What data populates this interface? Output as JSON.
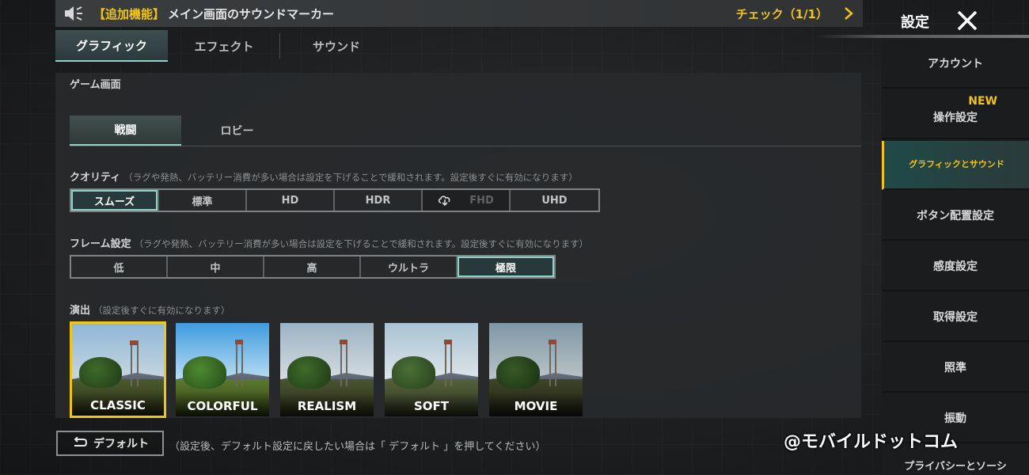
{
  "notice": {
    "tag": "【追加機能】",
    "message": "メイン画面のサウンドマーカー",
    "check": "チェック（1/1）"
  },
  "tabs": [
    {
      "label": "グラフィック",
      "active": true
    },
    {
      "label": "エフェクト",
      "active": false
    },
    {
      "label": "サウンド",
      "active": false
    }
  ],
  "section_title": "ゲーム画面",
  "subtabs": [
    {
      "label": "戦闘",
      "active": true
    },
    {
      "label": "ロビー",
      "active": false
    }
  ],
  "quality": {
    "label": "クオリティ",
    "note": "（ラグや発熱、バッテリー消費が多い場合は設定を下げることで緩和されます。設定後すぐに有効になります）",
    "options": [
      "スムーズ",
      "標準",
      "HD",
      "HDR",
      "FHD",
      "UHD"
    ],
    "selected": "スムーズ",
    "disabled": "FHD"
  },
  "frame": {
    "label": "フレーム設定",
    "note": "（ラグや発熱、バッテリー消費が多い場合は設定を下げることで緩和されます。設定後すぐに有効になります）",
    "options": [
      "低",
      "中",
      "高",
      "ウルトラ",
      "極限"
    ],
    "selected": "極限"
  },
  "style": {
    "label": "演出",
    "note": "（設定後すぐに有効になります）",
    "options": [
      "CLASSIC",
      "COLORFUL",
      "REALISM",
      "SOFT",
      "MOVIE"
    ],
    "selected": "CLASSIC"
  },
  "default_button": "デフォルト",
  "default_note": "（設定後、デフォルト設定に戻したい場合は「 デフォルト 」を押してください）",
  "header": {
    "title": "設定"
  },
  "sidebar": {
    "items": [
      {
        "label": "アカウント"
      },
      {
        "label": "操作設定",
        "badge": "NEW"
      },
      {
        "label": "グラフィックとサウンド",
        "active": true
      },
      {
        "label": "ボタン配置設定"
      },
      {
        "label": "感度設定"
      },
      {
        "label": "取得設定"
      },
      {
        "label": "照準"
      },
      {
        "label": "振動"
      },
      {
        "label": "プライバシーとソーシ"
      }
    ]
  },
  "watermark": "@モバイルドットコム",
  "colors": {
    "accent_yellow": "#f0c419",
    "accent_teal": "#8fd3c8",
    "panel": "#282a2c"
  },
  "icons": [
    "speaker-icon",
    "chevron-right-icon",
    "close-icon",
    "cloud-download-icon",
    "reset-icon"
  ]
}
